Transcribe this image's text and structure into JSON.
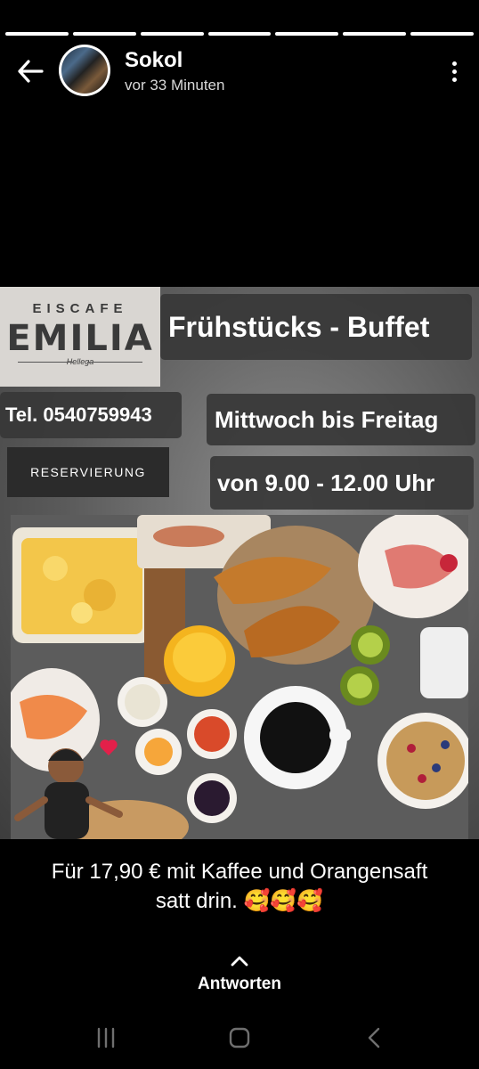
{
  "story": {
    "segments": 7,
    "user": "Sokol",
    "time": "vor 33 Minuten"
  },
  "poster": {
    "logo_top": "EISCAFE",
    "logo_name": "EMILIA",
    "logo_sub": "Hellega",
    "title": "Frühstücks - Buffet",
    "phone": "Tel. 0540759943",
    "days": "Mittwoch  bis  Freitag",
    "hours": "von 9.00 - 12.00 Uhr",
    "reservation": "RESERVIERUNG"
  },
  "caption": {
    "line1": "Für 17,90 € mit Kaffee und Orangensaft",
    "line2": "satt drin. 🥰🥰🥰"
  },
  "reply": {
    "label": "Antworten"
  },
  "icons": {
    "back": "arrow-back-icon",
    "more": "more-vertical-icon",
    "reply": "chevron-up-icon",
    "nav_recent": "recent-apps-icon",
    "nav_home": "home-icon",
    "nav_back": "nav-back-icon"
  }
}
